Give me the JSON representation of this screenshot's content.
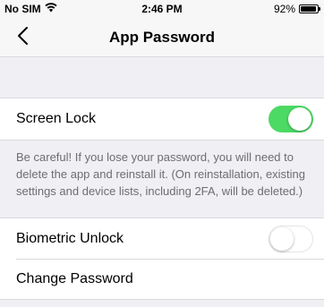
{
  "status_bar": {
    "carrier": "No SIM",
    "time": "2:46 PM",
    "battery_percent": "92%",
    "battery_level": 0.92,
    "icons": [
      "wifi-icon",
      "battery-icon"
    ]
  },
  "nav": {
    "back_icon": "chevron-left-icon",
    "title": "App Password"
  },
  "settings": {
    "screen_lock": {
      "label": "Screen Lock",
      "enabled": true
    },
    "note": "Be careful! If you lose your password, you will need to delete the app and reinstall it. (On reinstallation, existing settings and device lists, including 2FA, will be deleted.)",
    "biometric_unlock": {
      "label": "Biometric Unlock",
      "enabled": false
    },
    "change_password": {
      "label": "Change Password"
    }
  },
  "colors": {
    "toggle_on": "#4cd964",
    "background": "#efeff4"
  }
}
